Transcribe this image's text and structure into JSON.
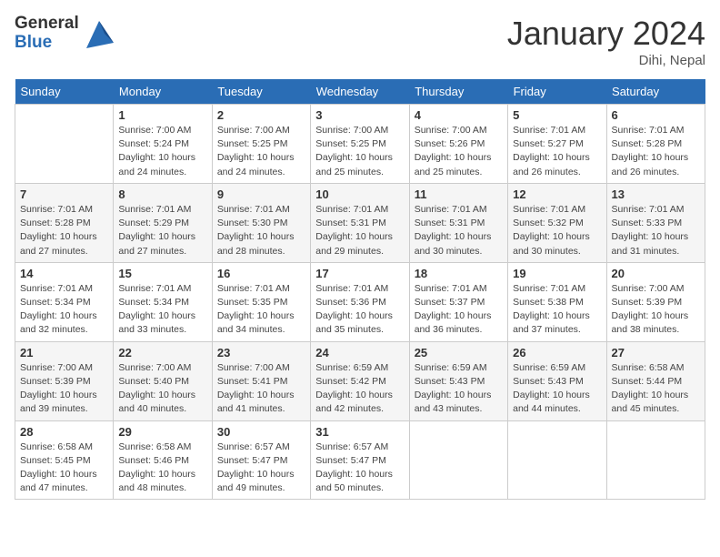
{
  "header": {
    "logo_general": "General",
    "logo_blue": "Blue",
    "month_year": "January 2024",
    "location": "Dihi, Nepal"
  },
  "days_of_week": [
    "Sunday",
    "Monday",
    "Tuesday",
    "Wednesday",
    "Thursday",
    "Friday",
    "Saturday"
  ],
  "weeks": [
    [
      null,
      {
        "day": 1,
        "sunrise": "7:00 AM",
        "sunset": "5:24 PM",
        "daylight": "10 hours and 24 minutes."
      },
      {
        "day": 2,
        "sunrise": "7:00 AM",
        "sunset": "5:25 PM",
        "daylight": "10 hours and 24 minutes."
      },
      {
        "day": 3,
        "sunrise": "7:00 AM",
        "sunset": "5:25 PM",
        "daylight": "10 hours and 25 minutes."
      },
      {
        "day": 4,
        "sunrise": "7:00 AM",
        "sunset": "5:26 PM",
        "daylight": "10 hours and 25 minutes."
      },
      {
        "day": 5,
        "sunrise": "7:01 AM",
        "sunset": "5:27 PM",
        "daylight": "10 hours and 26 minutes."
      },
      {
        "day": 6,
        "sunrise": "7:01 AM",
        "sunset": "5:28 PM",
        "daylight": "10 hours and 26 minutes."
      }
    ],
    [
      {
        "day": 7,
        "sunrise": "7:01 AM",
        "sunset": "5:28 PM",
        "daylight": "10 hours and 27 minutes."
      },
      {
        "day": 8,
        "sunrise": "7:01 AM",
        "sunset": "5:29 PM",
        "daylight": "10 hours and 27 minutes."
      },
      {
        "day": 9,
        "sunrise": "7:01 AM",
        "sunset": "5:30 PM",
        "daylight": "10 hours and 28 minutes."
      },
      {
        "day": 10,
        "sunrise": "7:01 AM",
        "sunset": "5:31 PM",
        "daylight": "10 hours and 29 minutes."
      },
      {
        "day": 11,
        "sunrise": "7:01 AM",
        "sunset": "5:31 PM",
        "daylight": "10 hours and 30 minutes."
      },
      {
        "day": 12,
        "sunrise": "7:01 AM",
        "sunset": "5:32 PM",
        "daylight": "10 hours and 30 minutes."
      },
      {
        "day": 13,
        "sunrise": "7:01 AM",
        "sunset": "5:33 PM",
        "daylight": "10 hours and 31 minutes."
      }
    ],
    [
      {
        "day": 14,
        "sunrise": "7:01 AM",
        "sunset": "5:34 PM",
        "daylight": "10 hours and 32 minutes."
      },
      {
        "day": 15,
        "sunrise": "7:01 AM",
        "sunset": "5:34 PM",
        "daylight": "10 hours and 33 minutes."
      },
      {
        "day": 16,
        "sunrise": "7:01 AM",
        "sunset": "5:35 PM",
        "daylight": "10 hours and 34 minutes."
      },
      {
        "day": 17,
        "sunrise": "7:01 AM",
        "sunset": "5:36 PM",
        "daylight": "10 hours and 35 minutes."
      },
      {
        "day": 18,
        "sunrise": "7:01 AM",
        "sunset": "5:37 PM",
        "daylight": "10 hours and 36 minutes."
      },
      {
        "day": 19,
        "sunrise": "7:01 AM",
        "sunset": "5:38 PM",
        "daylight": "10 hours and 37 minutes."
      },
      {
        "day": 20,
        "sunrise": "7:00 AM",
        "sunset": "5:39 PM",
        "daylight": "10 hours and 38 minutes."
      }
    ],
    [
      {
        "day": 21,
        "sunrise": "7:00 AM",
        "sunset": "5:39 PM",
        "daylight": "10 hours and 39 minutes."
      },
      {
        "day": 22,
        "sunrise": "7:00 AM",
        "sunset": "5:40 PM",
        "daylight": "10 hours and 40 minutes."
      },
      {
        "day": 23,
        "sunrise": "7:00 AM",
        "sunset": "5:41 PM",
        "daylight": "10 hours and 41 minutes."
      },
      {
        "day": 24,
        "sunrise": "6:59 AM",
        "sunset": "5:42 PM",
        "daylight": "10 hours and 42 minutes."
      },
      {
        "day": 25,
        "sunrise": "6:59 AM",
        "sunset": "5:43 PM",
        "daylight": "10 hours and 43 minutes."
      },
      {
        "day": 26,
        "sunrise": "6:59 AM",
        "sunset": "5:43 PM",
        "daylight": "10 hours and 44 minutes."
      },
      {
        "day": 27,
        "sunrise": "6:58 AM",
        "sunset": "5:44 PM",
        "daylight": "10 hours and 45 minutes."
      }
    ],
    [
      {
        "day": 28,
        "sunrise": "6:58 AM",
        "sunset": "5:45 PM",
        "daylight": "10 hours and 47 minutes."
      },
      {
        "day": 29,
        "sunrise": "6:58 AM",
        "sunset": "5:46 PM",
        "daylight": "10 hours and 48 minutes."
      },
      {
        "day": 30,
        "sunrise": "6:57 AM",
        "sunset": "5:47 PM",
        "daylight": "10 hours and 49 minutes."
      },
      {
        "day": 31,
        "sunrise": "6:57 AM",
        "sunset": "5:47 PM",
        "daylight": "10 hours and 50 minutes."
      },
      null,
      null,
      null
    ]
  ]
}
